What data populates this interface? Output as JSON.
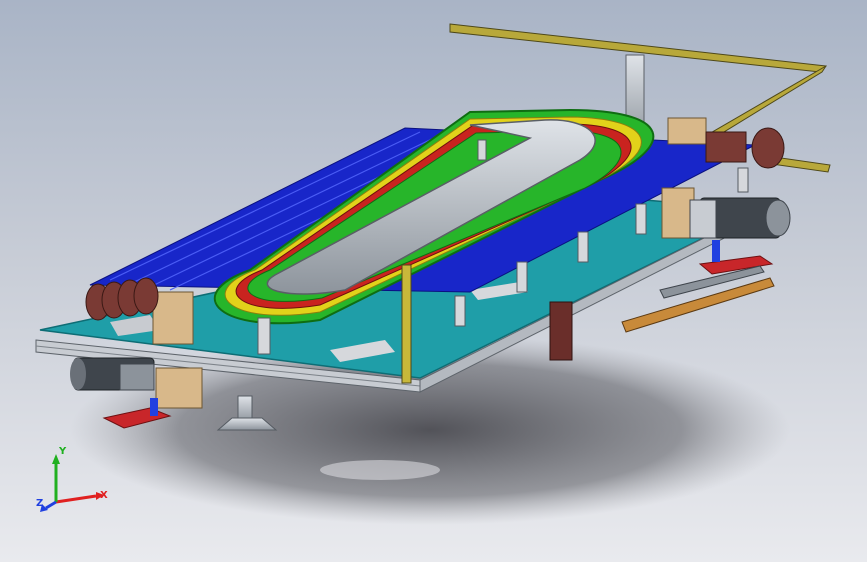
{
  "viewport": {
    "background_top": "#a9b4c6",
    "background_bottom": "#e9eaee"
  },
  "colors": {
    "plate_cyan": "#1f9ea8",
    "plate_edge": "#0e6d75",
    "belt_blue": "#1826c9",
    "belt_blue_light": "#3344ee",
    "track_green": "#27b52a",
    "track_yellow": "#e2d21a",
    "track_red": "#c9231f",
    "steel_gray": "#8c939b",
    "frame_aluminium": "#c8ccd2",
    "rail_yellow": "#b8a83a",
    "rail_orange": "#c88a3a",
    "motor_dark": "#3f454c",
    "bracket_tan": "#d8b88a",
    "pedestal_red": "#c8262a",
    "pulley_brown": "#7a3a34",
    "leg_maroon": "#6a2e2a"
  },
  "triad": {
    "x_label": "X",
    "y_label": "Y",
    "z_label": "Z",
    "x_color": "#e02020",
    "y_color": "#20b020",
    "z_color": "#2040e0"
  }
}
